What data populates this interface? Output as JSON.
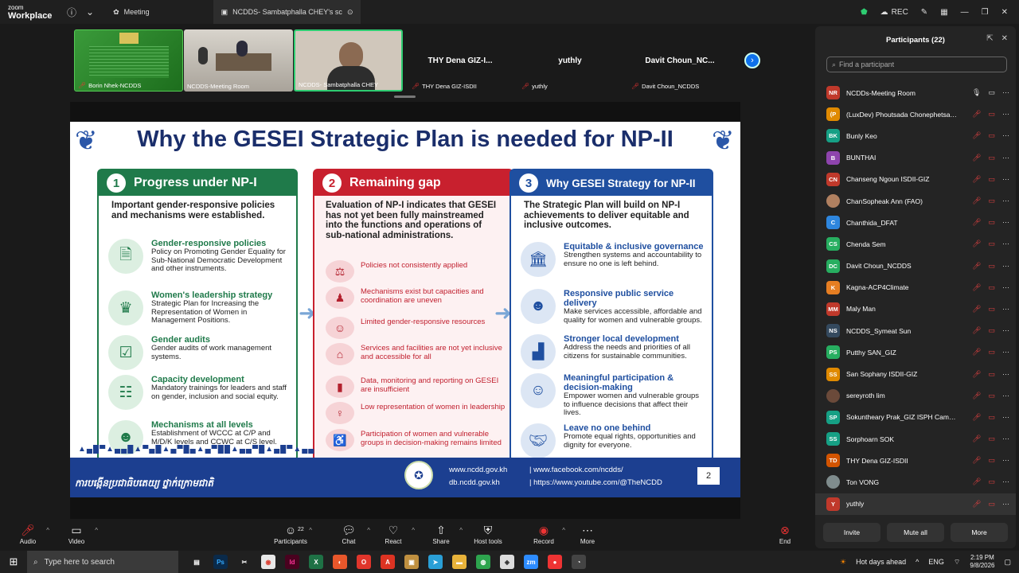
{
  "app": {
    "logo_line1": "zoom",
    "logo_line2": "Workplace"
  },
  "topbar": {
    "tabs": [
      {
        "label": "Meeting"
      },
      {
        "label": "NCDDS- Sambatphalla CHEY's sc"
      }
    ],
    "rec_label": "REC"
  },
  "video_tiles": [
    {
      "name": "Borin Nhek-NCDDS"
    },
    {
      "name": "NCDDS-Meeting Room"
    },
    {
      "name": "NCDDS- Sambatphalla CHEY"
    }
  ],
  "name_tiles": [
    {
      "big": "THY Dena GIZ-I...",
      "name": "THY Dena GIZ-ISDII"
    },
    {
      "big": "yuthly",
      "name": "yuthly"
    },
    {
      "big": "Davit Choun_NC...",
      "name": "Davit Choun_NCDDS"
    }
  ],
  "slide": {
    "title": "Why the GESEI Strategic Plan is needed for NP-II",
    "col1": {
      "num": "1",
      "title": "Progress under NP-I",
      "intro": "Important gender-responsive policies and mechanisms were established.",
      "items": [
        {
          "head": "Gender-responsive policies",
          "body": "Policy on Promoting Gender Equality for Sub-National Democratic Development and other instruments.",
          "icon": "policy-document-icon"
        },
        {
          "head": "Women's leadership strategy",
          "body": "Strategic Plan for Increasing the Representation of Women in Management Positions.",
          "icon": "woman-leader-icon"
        },
        {
          "head": "Gender audits",
          "body": "Gender audits of work management systems.",
          "icon": "audit-clipboard-icon"
        },
        {
          "head": "Capacity development",
          "body": "Mandatory trainings for leaders and staff on gender, inclusion and social equity.",
          "icon": "training-icon"
        },
        {
          "head": "Mechanisms at all levels",
          "body": "Establishment of WCCC at C/P and M/D/K levels and CCWC at C/S level.",
          "icon": "group-icon"
        }
      ]
    },
    "col2": {
      "num": "2",
      "title": "Remaining gap",
      "intro": "Evaluation of NP-I indicates that GESEI has not yet been fully mainstreamed into the functions and operations of sub-national administrations.",
      "items": [
        {
          "text": "Policies not consistently applied",
          "icon": "scales-icon"
        },
        {
          "text": "Mechanisms exist but capacities and coordination are uneven",
          "icon": "hierarchy-icon"
        },
        {
          "text": "Limited gender-responsive resources",
          "icon": "people-icon"
        },
        {
          "text": "Services and facilities are not yet inclusive and accessible for all",
          "icon": "building-icon"
        },
        {
          "text": "Data, monitoring and reporting on GESEI are insufficient",
          "icon": "bar-chart-icon"
        },
        {
          "text": "Low representation of women in leadership",
          "icon": "woman-icon"
        },
        {
          "text": "Participation of women and vulnerable groups in decision-making remains limited",
          "icon": "wheelchair-icon"
        }
      ]
    },
    "col3": {
      "num": "3",
      "title": "Why GESEI Strategy for NP-II",
      "intro": "The Strategic Plan will build on NP-I achievements to deliver equitable and inclusive outcomes.",
      "items": [
        {
          "head": "Equitable & inclusive governance",
          "body": "Strengthen systems and accountability to ensure no one is left behind.",
          "icon": "government-building-icon"
        },
        {
          "head": "Responsive public service delivery",
          "body": "Make services accessible, affordable and quality for women and vulnerable groups.",
          "icon": "community-icon"
        },
        {
          "head": "Stronger local development",
          "body": "Address the needs and priorities of all citizens for sustainable communities.",
          "icon": "growth-chart-icon"
        },
        {
          "head": "Meaningful participation & decision-making",
          "body": "Empower women and vulnerable groups to influence decisions that affect their lives.",
          "icon": "participation-icon"
        },
        {
          "head": "Leave no one behind",
          "body": "Promote equal rights, opportunities and dignity for everyone.",
          "icon": "handshake-icon"
        }
      ]
    },
    "footer": {
      "khmer": "ការបង្កើនប្រជាធិបតេយ្យ ថ្នាក់ក្រោមជាតិ",
      "web1": "www.ncdd.gov.kh",
      "web2": "db.ncdd.gov.kh",
      "fb": "www.facebook.com/ncdds/",
      "yt": "https://www.youtube.com/@TheNCDD",
      "page": "2"
    },
    "colors": {
      "green": "#1f7a4a",
      "red": "#c8202e",
      "blue": "#1f4fa0",
      "navy": "#1a2e6b"
    }
  },
  "participants": {
    "title": "Participants (22)",
    "search_placeholder": "Find a participant",
    "list": [
      {
        "initials": "NR",
        "name": "NCDDs-Meeting Room",
        "color": "#c0392b",
        "mic": "on"
      },
      {
        "initials": "(P",
        "name": "(LuxDev) Phoutsada Chonephetsala...",
        "color": "#e08a00",
        "mic": "off"
      },
      {
        "initials": "BK",
        "name": "Bunly Keo",
        "color": "#16a085",
        "mic": "off"
      },
      {
        "initials": "B",
        "name": "BUNTHAI",
        "color": "#8e44ad",
        "mic": "off"
      },
      {
        "initials": "CN",
        "name": "Chanseng Ngoun ISDII-GIZ",
        "color": "#c0392b",
        "mic": "off"
      },
      {
        "initials": "",
        "name": "ChanSopheak Ann (FAO)",
        "color": "#b08060",
        "mic": "off"
      },
      {
        "initials": "C",
        "name": "Chanthida_DFAT",
        "color": "#2e86de",
        "mic": "off"
      },
      {
        "initials": "CS",
        "name": "Chenda Sem",
        "color": "#27ae60",
        "mic": "off"
      },
      {
        "initials": "DC",
        "name": "Davit Choun_NCDDS",
        "color": "#27ae60",
        "mic": "off"
      },
      {
        "initials": "K",
        "name": "Kagna-ACP4Climate",
        "color": "#e67e22",
        "mic": "off"
      },
      {
        "initials": "MM",
        "name": "Maly Man",
        "color": "#c0392b",
        "mic": "off"
      },
      {
        "initials": "NS",
        "name": "NCDDS_Symeat Sun",
        "color": "#34495e",
        "mic": "off"
      },
      {
        "initials": "PS",
        "name": "Putthy SAN_GIZ",
        "color": "#27ae60",
        "mic": "off"
      },
      {
        "initials": "SS",
        "name": "San Sophany ISDII-GIZ",
        "color": "#e08a00",
        "mic": "off"
      },
      {
        "initials": "",
        "name": "sereyroth lim",
        "color": "#6b4a3a",
        "mic": "off"
      },
      {
        "initials": "SP",
        "name": "Sokuntheary Prak_GIZ ISPH Cambo...",
        "color": "#16a085",
        "mic": "off"
      },
      {
        "initials": "SS",
        "name": "Sorphoarn SOK",
        "color": "#16a085",
        "mic": "off"
      },
      {
        "initials": "TD",
        "name": "THY Dena GIZ-ISDII",
        "color": "#d35400",
        "mic": "off"
      },
      {
        "initials": "",
        "name": "Ton VONG",
        "color": "#7f8c8d",
        "mic": "off"
      },
      {
        "initials": "Y",
        "name": "yuthly",
        "color": "#c0392b",
        "mic": "off"
      }
    ],
    "buttons": {
      "invite": "Invite",
      "mute_all": "Mute all",
      "more": "More"
    }
  },
  "controls": {
    "audio": "Audio",
    "video": "Video",
    "participants": "Participants",
    "participants_count": "22",
    "chat": "Chat",
    "react": "React",
    "share": "Share",
    "host_tools": "Host tools",
    "record": "Record",
    "more": "More",
    "end": "End"
  },
  "taskbar": {
    "search_placeholder": "Type here to search",
    "weather": "Hot days ahead",
    "lang": "ENG",
    "time": "2:19 PM",
    "date": "9/8/2026"
  }
}
